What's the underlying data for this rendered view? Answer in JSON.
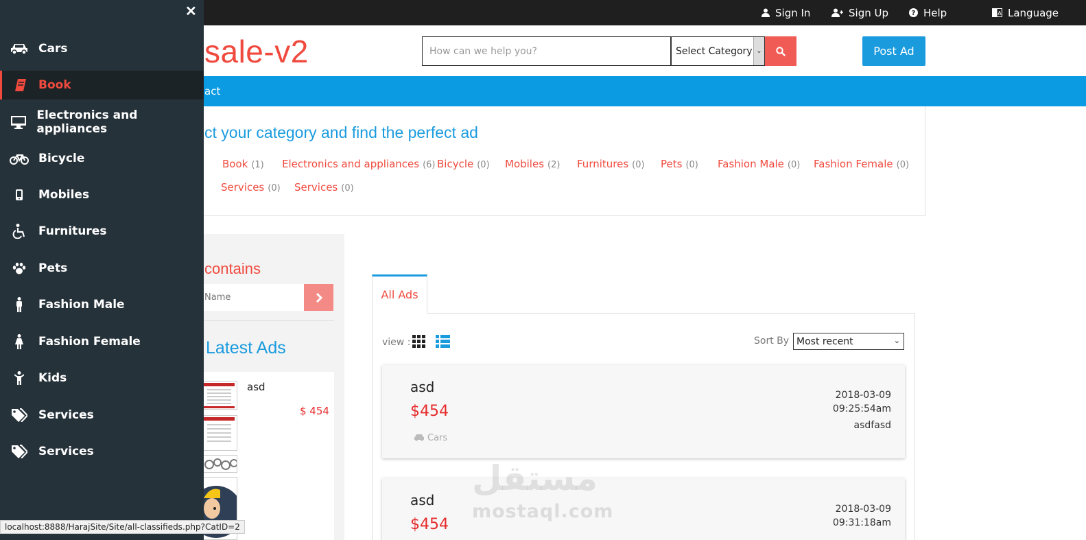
{
  "topbar": {
    "sign_in": "Sign In",
    "sign_up": "Sign Up",
    "help": "Help",
    "language": "Language"
  },
  "header": {
    "logo": "sale-v2",
    "search_placeholder": "How can we help you?",
    "category_select": "Select Category",
    "post_ad": "Post Ad"
  },
  "nav": {
    "contact": "act"
  },
  "categories": {
    "heading": "ct your category and find the perfect ad",
    "items": [
      {
        "label": "Book",
        "count": "(1)"
      },
      {
        "label": "Electronics and appliances",
        "count": "(6)"
      },
      {
        "label": "Bicycle",
        "count": "(0)"
      },
      {
        "label": "Mobiles",
        "count": "(2)"
      },
      {
        "label": "Furnitures",
        "count": "(0)"
      },
      {
        "label": "Pets",
        "count": "(0)"
      },
      {
        "label": "Fashion Male",
        "count": "(0)"
      },
      {
        "label": "Fashion Female",
        "count": "(0)"
      },
      {
        "label": "Services",
        "count": "(0)"
      },
      {
        "label": "Services",
        "count": "(0)"
      }
    ]
  },
  "left": {
    "contains_title": "contains",
    "name_placeholder": "Name",
    "latest_title": "Latest Ads",
    "latest_item": {
      "name": "asd",
      "price": "$ 454"
    }
  },
  "ads": {
    "tab_all": "All Ads",
    "view_label": "view :",
    "sort_label": "Sort By :",
    "sort_value": "Most recent",
    "items": [
      {
        "title": "asd",
        "price": "$454",
        "category": "Cars",
        "date": "2018-03-09",
        "time": "09:25:54am",
        "user": "asdfasd"
      },
      {
        "title": "asd",
        "price": "$454",
        "date": "2018-03-09",
        "time": "09:31:18am"
      }
    ]
  },
  "sidebar": {
    "items": [
      {
        "label": "Cars",
        "icon": "car-icon"
      },
      {
        "label": "Book",
        "icon": "book-icon"
      },
      {
        "label": "Electronics and appliances",
        "icon": "desktop-icon"
      },
      {
        "label": "Bicycle",
        "icon": "bicycle-icon"
      },
      {
        "label": "Mobiles",
        "icon": "mobile-icon"
      },
      {
        "label": "Furnitures",
        "icon": "wheelchair-icon"
      },
      {
        "label": "Pets",
        "icon": "paw-icon"
      },
      {
        "label": "Fashion Male",
        "icon": "male-icon"
      },
      {
        "label": "Fashion Female",
        "icon": "female-icon"
      },
      {
        "label": "Kids",
        "icon": "child-icon"
      },
      {
        "label": "Services",
        "icon": "tags-icon"
      },
      {
        "label": "Services",
        "icon": "tags-icon"
      }
    ],
    "active": "Book"
  },
  "watermark": {
    "arabic": "مستقل",
    "latin": "mostaql.com"
  },
  "status_url": "localhost:8888/HarajSite/Site/all-classifieds.php?CatID=2",
  "colors": {
    "accent_red": "#f04a3e",
    "accent_blue": "#1a9bde",
    "sidebar_bg": "#26323a",
    "topbar_bg": "#1f1f1f"
  }
}
